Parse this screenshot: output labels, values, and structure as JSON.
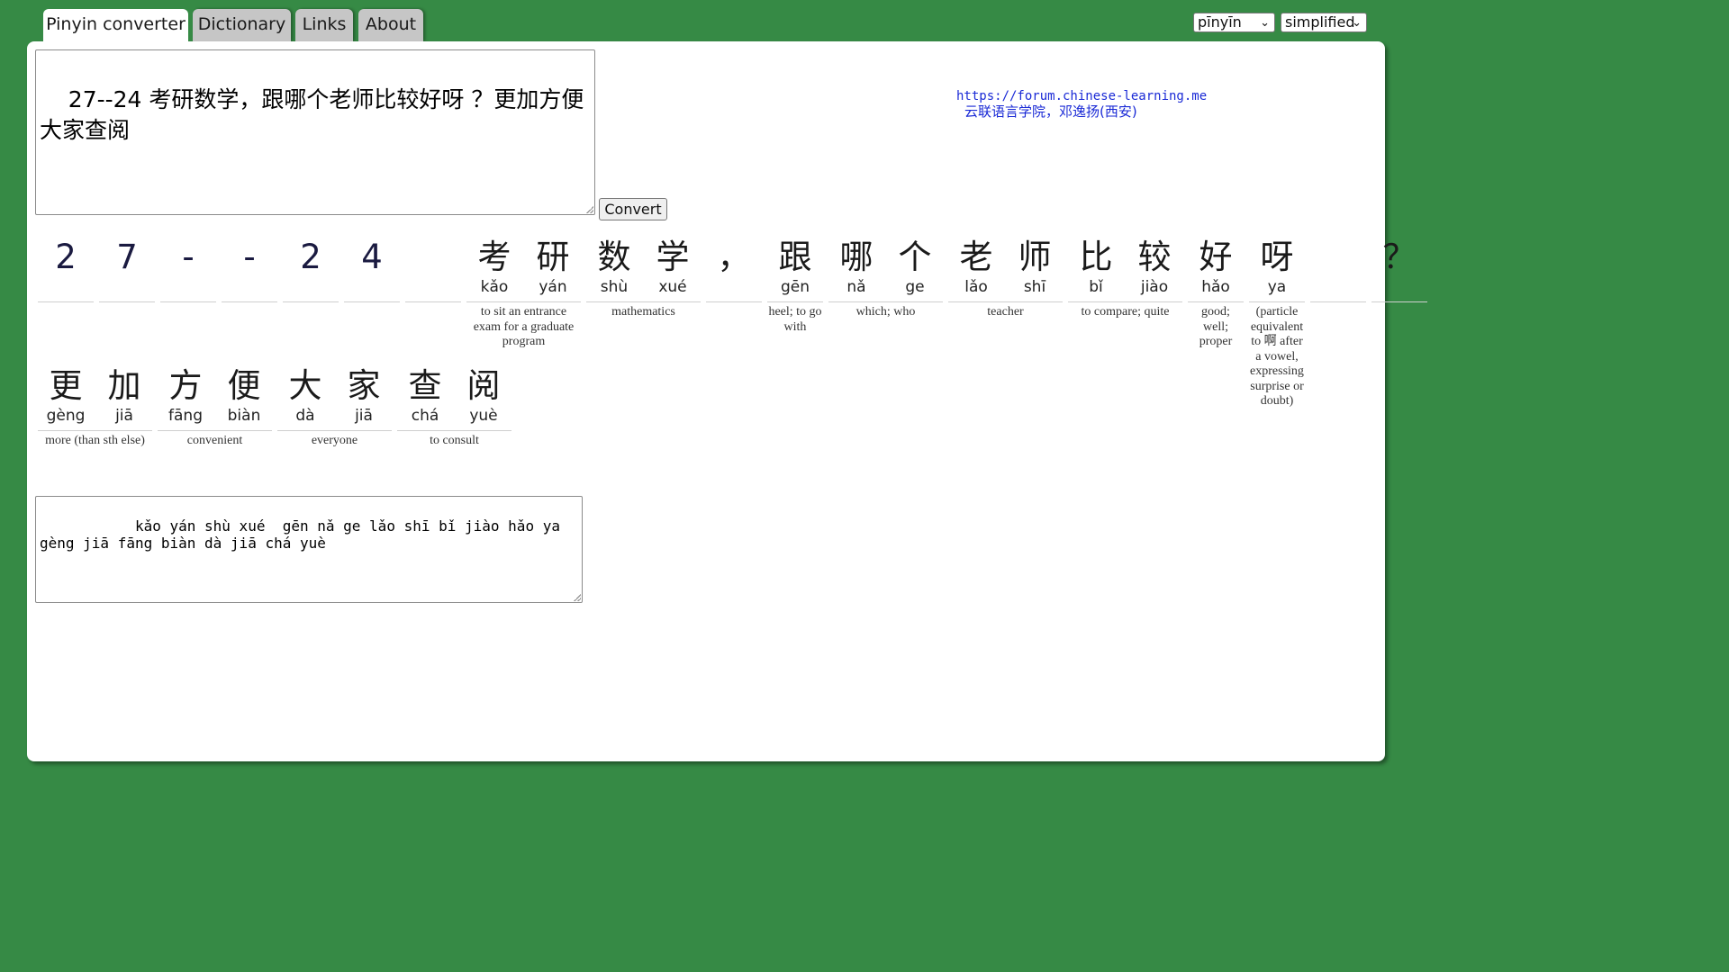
{
  "tabs": [
    {
      "label": "Pinyin converter",
      "active": true
    },
    {
      "label": "Dictionary",
      "active": false
    },
    {
      "label": "Links",
      "active": false
    },
    {
      "label": "About",
      "active": false
    }
  ],
  "selects": {
    "mode": {
      "value": "pīnyīn"
    },
    "script": {
      "value": "simplified"
    }
  },
  "input": {
    "value": "27--24 考研数学，跟哪个老师比较好呀 ？更加方便大家查阅"
  },
  "convert_label": "Convert",
  "credits": {
    "url": "https://forum.chinese-learning.me",
    "line2": "云联语言学院，邓逸扬(西安)"
  },
  "segments": [
    {
      "chars": [
        {
          "h": "2",
          "p": ""
        }
      ],
      "gloss": ""
    },
    {
      "chars": [
        {
          "h": "7",
          "p": ""
        }
      ],
      "gloss": ""
    },
    {
      "chars": [
        {
          "h": "-",
          "p": ""
        }
      ],
      "gloss": ""
    },
    {
      "chars": [
        {
          "h": "-",
          "p": ""
        }
      ],
      "gloss": ""
    },
    {
      "chars": [
        {
          "h": "2",
          "p": ""
        }
      ],
      "gloss": ""
    },
    {
      "chars": [
        {
          "h": "4",
          "p": ""
        }
      ],
      "gloss": ""
    },
    {
      "chars": [
        {
          "h": " ",
          "p": ""
        }
      ],
      "gloss": ""
    },
    {
      "chars": [
        {
          "h": "考",
          "p": "kǎo"
        },
        {
          "h": "研",
          "p": "yán"
        }
      ],
      "gloss": "to sit an entrance exam for a graduate program"
    },
    {
      "chars": [
        {
          "h": "数",
          "p": "shù"
        },
        {
          "h": "学",
          "p": "xué"
        }
      ],
      "gloss": "mathematics"
    },
    {
      "chars": [
        {
          "h": "，",
          "p": ""
        }
      ],
      "gloss": ""
    },
    {
      "chars": [
        {
          "h": "跟",
          "p": "gēn"
        }
      ],
      "gloss": "heel; to go with"
    },
    {
      "chars": [
        {
          "h": "哪",
          "p": "nǎ"
        },
        {
          "h": "个",
          "p": "ge"
        }
      ],
      "gloss": "which; who"
    },
    {
      "chars": [
        {
          "h": "老",
          "p": "lǎo"
        },
        {
          "h": "师",
          "p": "shī"
        }
      ],
      "gloss": "teacher"
    },
    {
      "chars": [
        {
          "h": "比",
          "p": "bǐ"
        },
        {
          "h": "较",
          "p": "jiào"
        }
      ],
      "gloss": "to compare; quite"
    },
    {
      "chars": [
        {
          "h": "好",
          "p": "hǎo"
        }
      ],
      "gloss": "good; well; proper"
    },
    {
      "chars": [
        {
          "h": "呀",
          "p": "ya"
        }
      ],
      "gloss": "(particle equivalent to 啊 after a vowel, expressing surprise or doubt)"
    },
    {
      "chars": [
        {
          "h": " ",
          "p": ""
        }
      ],
      "gloss": ""
    },
    {
      "chars": [
        {
          "h": "？",
          "p": ""
        }
      ],
      "gloss": ""
    },
    {
      "chars": [
        {
          "h": "更",
          "p": "gèng"
        },
        {
          "h": "加",
          "p": "jiā"
        }
      ],
      "gloss": "more (than sth else)"
    },
    {
      "chars": [
        {
          "h": "方",
          "p": "fāng"
        },
        {
          "h": "便",
          "p": "biàn"
        }
      ],
      "gloss": "convenient"
    },
    {
      "chars": [
        {
          "h": "大",
          "p": "dà"
        },
        {
          "h": "家",
          "p": "jiā"
        }
      ],
      "gloss": "everyone"
    },
    {
      "chars": [
        {
          "h": "查",
          "p": "chá"
        },
        {
          "h": "阅",
          "p": "yuè"
        }
      ],
      "gloss": "to consult"
    }
  ],
  "output": {
    "value": "       kǎo yán shù xué  gēn nǎ ge lǎo shī bǐ jiào hǎo ya\ngèng jiā fāng biàn dà jiā chá yuè"
  }
}
